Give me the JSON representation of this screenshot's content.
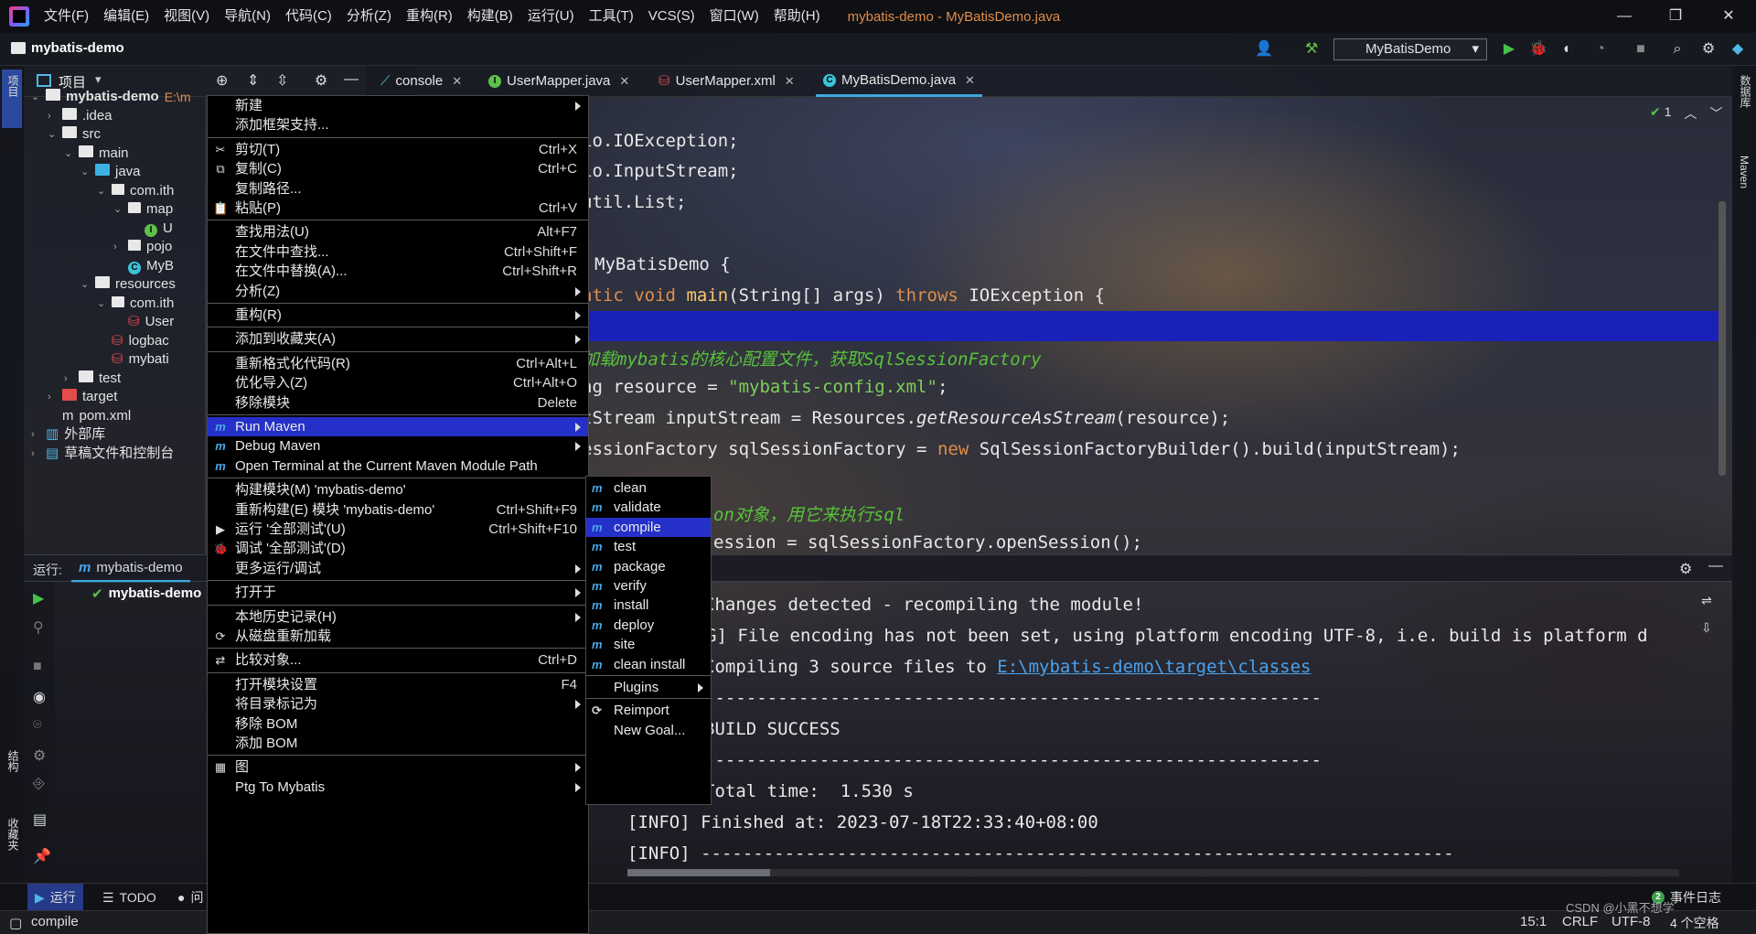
{
  "window": {
    "title": "mybatis-demo - MyBatisDemo.java",
    "menu": [
      "文件(F)",
      "编辑(E)",
      "视图(V)",
      "导航(N)",
      "代码(C)",
      "分析(Z)",
      "重构(R)",
      "构建(B)",
      "运行(U)",
      "工具(T)",
      "VCS(S)",
      "窗口(W)",
      "帮助(H)"
    ],
    "controls": {
      "minimize": "—",
      "restore": "❐",
      "close": "✕"
    }
  },
  "navbar": {
    "project": "mybatis-demo",
    "run_config": "MyBatisDemo"
  },
  "sidestrips": {
    "left_top": "项目",
    "left_structure": "结构",
    "left_fav": "收藏夹",
    "right_db": "数据库",
    "right_maven": "Maven"
  },
  "project_panel": {
    "title": "项目",
    "tree": [
      {
        "label": "mybatis-demo",
        "suffix": "E:\\m",
        "indent": 0,
        "icon": "folder",
        "bold": true,
        "open": true
      },
      {
        "label": ".idea",
        "indent": 1,
        "icon": "folder",
        "open": false
      },
      {
        "label": "src",
        "indent": 1,
        "icon": "folder",
        "open": true
      },
      {
        "label": "main",
        "indent": 2,
        "icon": "folder",
        "open": true
      },
      {
        "label": "java",
        "indent": 3,
        "icon": "folder-blue",
        "open": true
      },
      {
        "label": "com.ith",
        "indent": 4,
        "icon": "package",
        "open": true
      },
      {
        "label": "map",
        "indent": 5,
        "icon": "package",
        "open": true
      },
      {
        "label": "U",
        "indent": 6,
        "icon": "interface"
      },
      {
        "label": "pojo",
        "indent": 5,
        "icon": "package",
        "open": false
      },
      {
        "label": "MyB",
        "indent": 5,
        "icon": "class"
      },
      {
        "label": "resources",
        "indent": 3,
        "icon": "folder",
        "open": true
      },
      {
        "label": "com.ith",
        "indent": 4,
        "icon": "package",
        "open": true
      },
      {
        "label": "User",
        "indent": 5,
        "icon": "xml"
      },
      {
        "label": "logbac",
        "indent": 4,
        "icon": "xml"
      },
      {
        "label": "mybati",
        "indent": 4,
        "icon": "xml"
      },
      {
        "label": "test",
        "indent": 2,
        "icon": "folder",
        "open": false
      },
      {
        "label": "target",
        "indent": 1,
        "icon": "folder-red",
        "open": false
      },
      {
        "label": "pom.xml",
        "indent": 1,
        "icon": "maven"
      },
      {
        "label": "外部库",
        "indent": 0,
        "icon": "lib",
        "open": false
      },
      {
        "label": "草稿文件和控制台",
        "indent": 0,
        "icon": "scratch",
        "open": false
      }
    ]
  },
  "tabs": [
    {
      "label": "console",
      "icon": "console"
    },
    {
      "label": "UserMapper.java",
      "icon": "interface"
    },
    {
      "label": "UserMapper.xml",
      "icon": "xml"
    },
    {
      "label": "MyBatisDemo.java",
      "icon": "class",
      "active": true
    }
  ],
  "editor": {
    "inspection_count": "1",
    "lines": [
      "io.IOException;",
      "io.InputStream;",
      "util.List;",
      "MyBatisDemo {",
      "atic void main(String[] args) throws IOException {",
      "",
      "加载mybatis的核心配置文件，获取SqlSessionFactory",
      "ng resource = \"mybatis-config.xml\";",
      "tStream inputStream = Resources.getResourceAsStream(resource);",
      "essionFactory sqlSessionFactory = new SqlSessionFactoryBuilder().build(inputStream);",
      "",
      "on对象，用它来执行sql",
      "ession = sqlSessionFactory.openSession();"
    ]
  },
  "run_panel": {
    "label": "运行:",
    "tab": "mybatis-demo",
    "tree_item": "mybatis-demo",
    "output": [
      "Changes detected - recompiling the module!",
      "G] File encoding has not been set, using platform encoding UTF-8, i.e. build is platform d",
      "Compiling 3 source files to ",
      "-----------------------------------------------------------",
      "BUILD SUCCESS",
      "-----------------------------------------------------------",
      "Total time:  1.530 s",
      "[INFO] Finished at: 2023-07-18T22:33:40+08:00",
      "[INFO] ------------------------------------------------------------------------"
    ],
    "output_link": "E:\\mybatis-demo\\target\\classes"
  },
  "context_menu": {
    "items": [
      {
        "label": "新建",
        "submenu": true
      },
      {
        "label": "添加框架支持..."
      },
      {
        "sep": true
      },
      {
        "label": "剪切(T)",
        "shortcut": "Ctrl+X",
        "icon": "✂"
      },
      {
        "label": "复制(C)",
        "shortcut": "Ctrl+C",
        "icon": "⧉"
      },
      {
        "label": "复制路径..."
      },
      {
        "label": "粘贴(P)",
        "shortcut": "Ctrl+V",
        "icon": "📋"
      },
      {
        "sep": true
      },
      {
        "label": "查找用法(U)",
        "shortcut": "Alt+F7"
      },
      {
        "label": "在文件中查找...",
        "shortcut": "Ctrl+Shift+F"
      },
      {
        "label": "在文件中替换(A)...",
        "shortcut": "Ctrl+Shift+R"
      },
      {
        "label": "分析(Z)",
        "submenu": true
      },
      {
        "sep": true
      },
      {
        "label": "重构(R)",
        "submenu": true
      },
      {
        "sep": true
      },
      {
        "label": "添加到收藏夹(A)",
        "submenu": true
      },
      {
        "sep": true
      },
      {
        "label": "重新格式化代码(R)",
        "shortcut": "Ctrl+Alt+L"
      },
      {
        "label": "优化导入(Z)",
        "shortcut": "Ctrl+Alt+O"
      },
      {
        "label": "移除模块",
        "shortcut": "Delete"
      },
      {
        "sep": true
      },
      {
        "label": "Run Maven",
        "submenu": true,
        "icon": "m",
        "highlight": true
      },
      {
        "label": "Debug Maven",
        "submenu": true,
        "icon": "m"
      },
      {
        "label": "Open Terminal at the Current Maven Module Path",
        "icon": "m"
      },
      {
        "sep": true
      },
      {
        "label": "构建模块(M) 'mybatis-demo'"
      },
      {
        "label": "重新构建(E) 模块 'mybatis-demo'",
        "shortcut": "Ctrl+Shift+F9"
      },
      {
        "label": "运行 '全部测试'(U)",
        "shortcut": "Ctrl+Shift+F10",
        "icon": "▶"
      },
      {
        "label": "调试 '全部测试'(D)",
        "icon": "🐞"
      },
      {
        "label": "更多运行/调试",
        "submenu": true
      },
      {
        "sep": true
      },
      {
        "label": "打开于",
        "submenu": true
      },
      {
        "sep": true
      },
      {
        "label": "本地历史记录(H)",
        "submenu": true
      },
      {
        "label": "从磁盘重新加载",
        "icon": "⟳"
      },
      {
        "sep": true
      },
      {
        "label": "比较对象...",
        "shortcut": "Ctrl+D",
        "icon": "⇄"
      },
      {
        "sep": true
      },
      {
        "label": "打开模块设置",
        "shortcut": "F4"
      },
      {
        "label": "将目录标记为",
        "submenu": true
      },
      {
        "label": "移除 BOM"
      },
      {
        "label": "添加 BOM"
      },
      {
        "sep": true
      },
      {
        "label": "图",
        "submenu": true,
        "icon": "▦"
      },
      {
        "label": "Ptg To Mybatis",
        "submenu": true
      }
    ]
  },
  "maven_submenu": {
    "items": [
      {
        "label": "clean",
        "icon": "m"
      },
      {
        "label": "validate",
        "icon": "m"
      },
      {
        "label": "compile",
        "icon": "m",
        "highlight": true
      },
      {
        "label": "test",
        "icon": "m"
      },
      {
        "label": "package",
        "icon": "m"
      },
      {
        "label": "verify",
        "icon": "m"
      },
      {
        "label": "install",
        "icon": "m"
      },
      {
        "label": "deploy",
        "icon": "m"
      },
      {
        "label": "site",
        "icon": "m"
      },
      {
        "label": "clean install",
        "icon": "m"
      },
      {
        "sep": true
      },
      {
        "label": "Plugins",
        "submenu": true
      },
      {
        "sep": true
      },
      {
        "label": "Reimport",
        "icon": "⟳"
      },
      {
        "label": "New Goal..."
      }
    ]
  },
  "bottom_tabs": [
    {
      "label": "运行",
      "icon": "▶",
      "active": true
    },
    {
      "label": "TODO",
      "icon": "☰"
    },
    {
      "label": "问",
      "icon": "●"
    }
  ],
  "event_log": {
    "count": "2",
    "label": "事件日志"
  },
  "status": {
    "message": "compile",
    "position": "15:1",
    "line_sep": "CRLF",
    "encoding": "UTF-8",
    "indent": "4 个空格",
    "watermark": "CSDN @小黑不想学"
  },
  "colors": {
    "accent": "#2530c8",
    "tab_underline": "#3fa7d9",
    "keyword": "#e08d4a",
    "string": "#7fcf5a",
    "comment": "#57c23a"
  }
}
